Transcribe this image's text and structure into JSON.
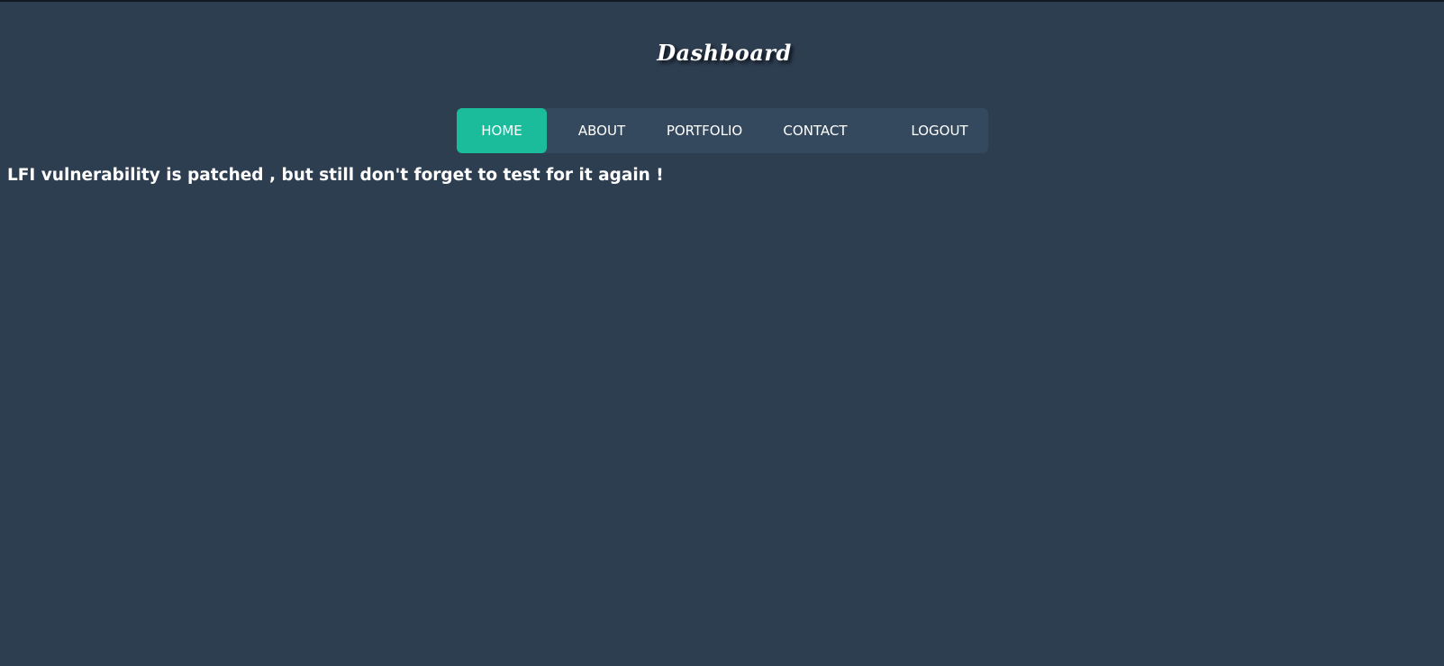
{
  "header": {
    "title": "Dashboard"
  },
  "nav": {
    "items": [
      {
        "label": "HOME",
        "active": true
      },
      {
        "label": "ABOUT",
        "active": false
      },
      {
        "label": "PORTFOLIO",
        "active": false
      },
      {
        "label": "CONTACT",
        "active": false
      },
      {
        "label": "LOGOUT",
        "active": false
      }
    ]
  },
  "main": {
    "notice": "LFI vulnerability is patched , but still don't forget to test for it again !"
  },
  "colors": {
    "background": "#2e3e51",
    "nav_background": "#34495e",
    "accent": "#1abc9c",
    "text": "#ffffff"
  }
}
